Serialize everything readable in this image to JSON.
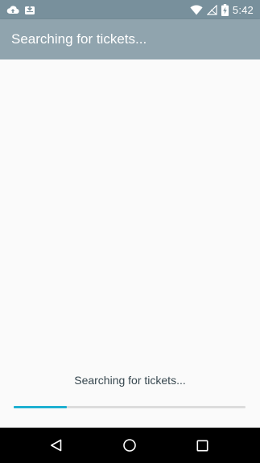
{
  "status_bar": {
    "time": "5:42",
    "icons_left": [
      "cloud-upload-icon",
      "download-box-icon"
    ],
    "icons_right": [
      "wifi-icon",
      "no-signal-icon",
      "battery-charging-icon"
    ]
  },
  "app_bar": {
    "title": "Searching for tickets..."
  },
  "main": {
    "progress_label": "Searching for tickets...",
    "progress_fraction": 0.23
  },
  "nav_bar": {
    "buttons": [
      "back-icon",
      "home-icon",
      "recents-icon"
    ]
  },
  "colors": {
    "status_bar": "#78909c",
    "app_bar": "#90a4ae",
    "background": "#fafafa",
    "progress_fill": "#1eb0d1",
    "progress_track": "#dcdcdc"
  }
}
